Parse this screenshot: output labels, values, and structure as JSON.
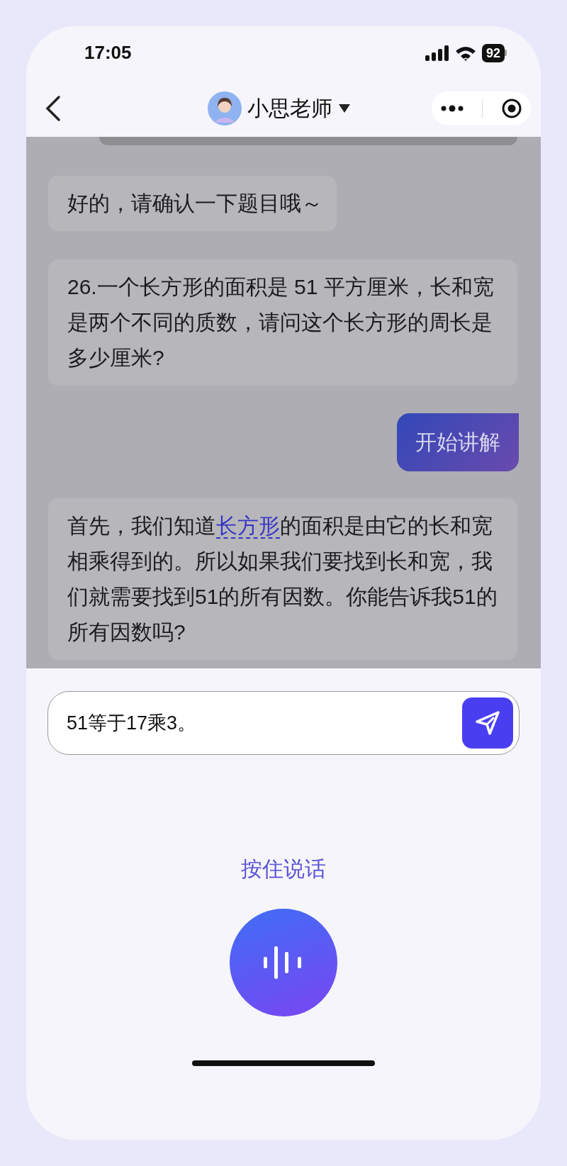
{
  "status_bar": {
    "time": "17:05",
    "battery": "92"
  },
  "nav": {
    "title": "小思老师"
  },
  "chat": {
    "dimmed": true,
    "messages": [
      {
        "kind": "bot",
        "segments": [
          {
            "text": "好的，请确认一下题目哦～"
          }
        ]
      },
      {
        "kind": "bot",
        "segments": [
          {
            "text": "26.一个长方形的面积是 51 平方厘米，长和宽是两个不同的质数，请问这个长方形的周长是多少厘米?"
          }
        ]
      },
      {
        "kind": "user",
        "segments": [
          {
            "text": "开始讲解"
          }
        ]
      },
      {
        "kind": "bot",
        "segments": [
          {
            "text": "首先，我们知道"
          },
          {
            "text": "长方形",
            "kind": "term"
          },
          {
            "text": "的面积是由它的长和宽相乘得到的。所以如果我们要找到长和宽，我们就需要找到51的所有因数。你能告诉我51的所有因数吗?"
          }
        ]
      }
    ]
  },
  "input": {
    "value": "51等于17乘3。"
  },
  "voice": {
    "label": "按住说话"
  }
}
